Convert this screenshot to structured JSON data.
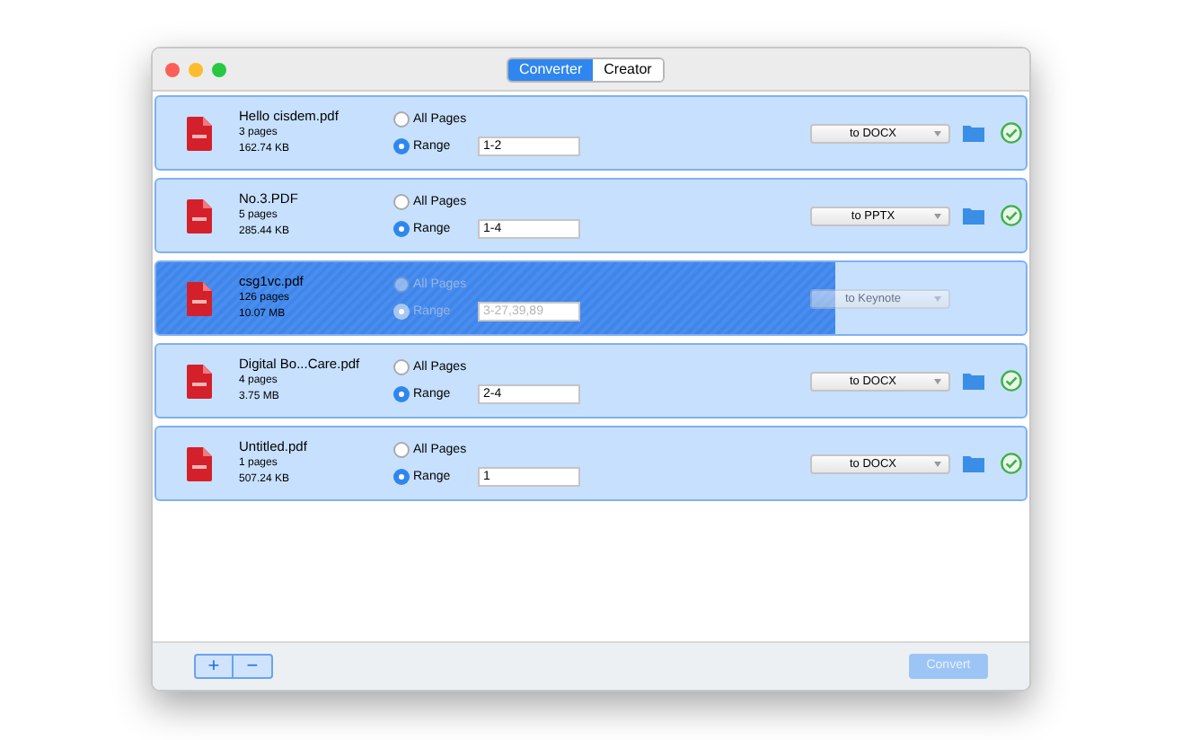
{
  "tabs": [
    {
      "label": "Converter",
      "selected": true
    },
    {
      "label": "Creator",
      "selected": false
    }
  ],
  "files": [
    {
      "name": "Hello cisdem.pdf",
      "pages": "3 pages",
      "size": "162.74 KB",
      "options": [
        {
          "label": "All Pages",
          "selected": false
        },
        {
          "label": "Range",
          "selected": true
        }
      ],
      "range": "1-2",
      "format": "to DOCX",
      "disabled": false,
      "done": true
    },
    {
      "name": "No.3.PDF",
      "pages": "5 pages",
      "size": "285.44 KB",
      "options": [
        {
          "label": "All Pages",
          "selected": false
        },
        {
          "label": "Range",
          "selected": true
        }
      ],
      "range": "1-4",
      "format": "to PPTX",
      "disabled": false,
      "done": true
    },
    {
      "name": "csg1vc.pdf",
      "pages": "126 pages",
      "size": "10.07 MB",
      "options": [
        {
          "label": "All Pages",
          "selected": false
        },
        {
          "label": "Range",
          "selected": true
        }
      ],
      "range": "3-27,39,89",
      "format": "to Keynote",
      "disabled": true,
      "done": false,
      "level": 0.78
    },
    {
      "name": "Digital Bo...Care.pdf",
      "pages": "4 pages",
      "size": "3.75 MB",
      "options": [
        {
          "label": "All Pages",
          "selected": false
        },
        {
          "label": "Range",
          "selected": true
        }
      ],
      "range": "2-4",
      "format": "to DOCX",
      "disabled": false,
      "done": true
    },
    {
      "name": "Untitled.pdf",
      "pages": "1 pages",
      "size": "507.24 KB",
      "options": [
        {
          "label": "All Pages",
          "selected": false
        },
        {
          "label": "Range",
          "selected": true
        }
      ],
      "range": "1",
      "format": "to DOCX",
      "disabled": false,
      "done": true
    }
  ],
  "add_button": "+",
  "remove_button": "−",
  "convert_button": {
    "label": "Convert",
    "disabled": true
  }
}
